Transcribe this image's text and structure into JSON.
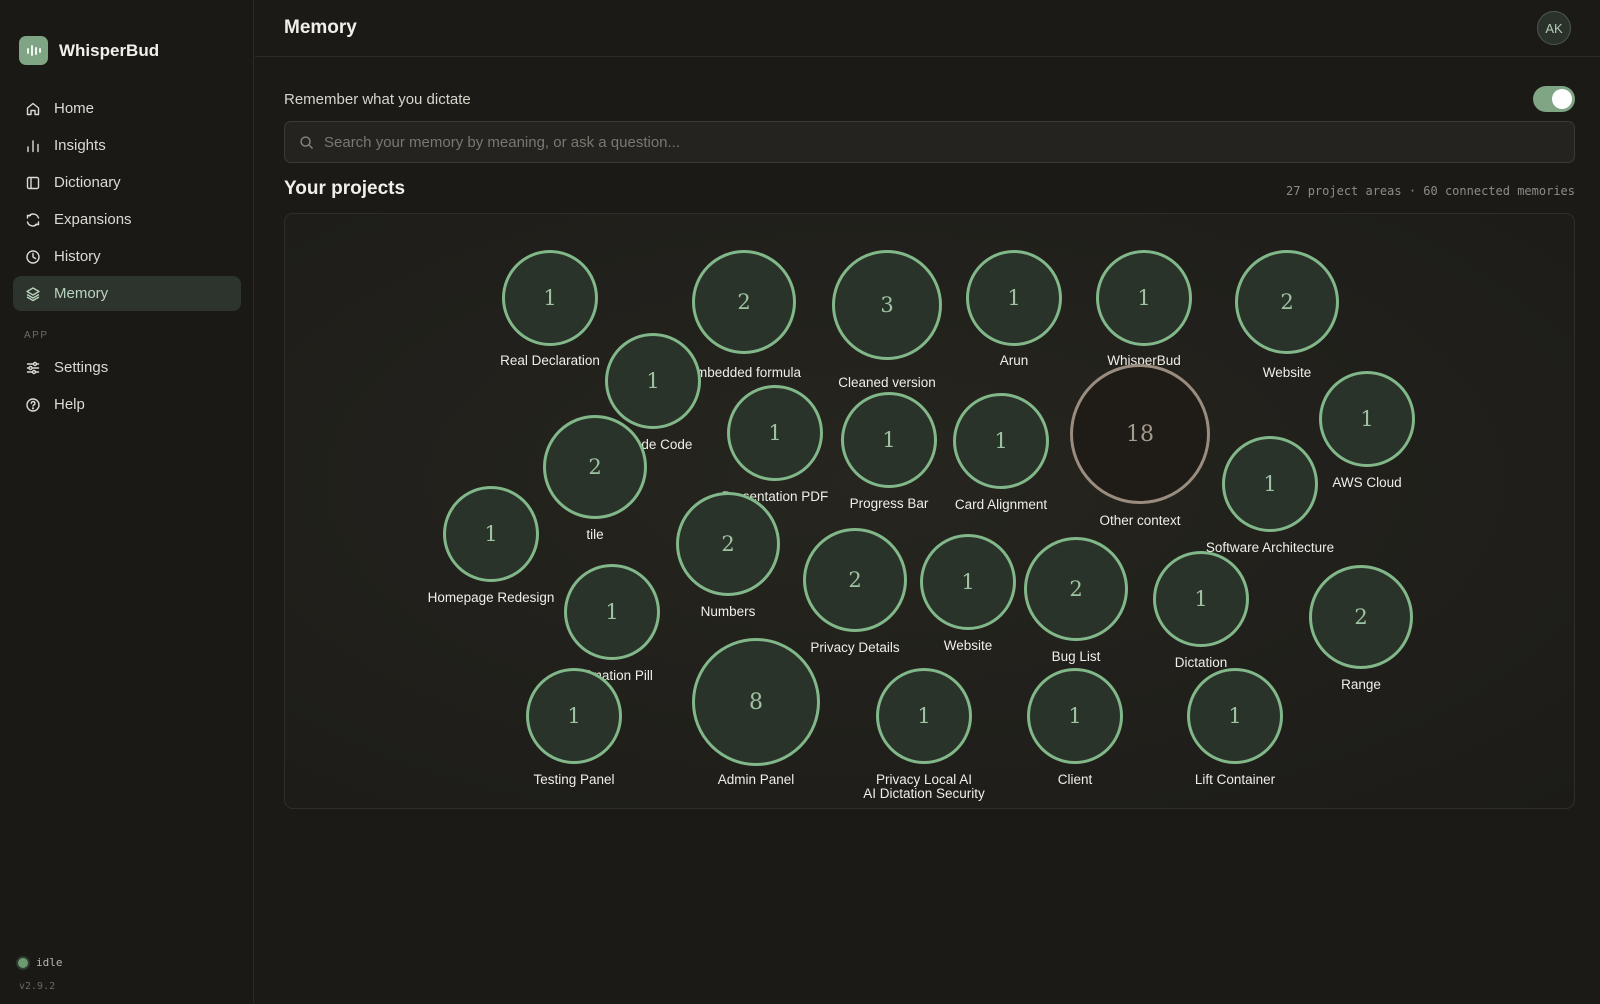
{
  "app": {
    "name": "WhisperBud"
  },
  "sidebar": {
    "items": [
      {
        "label": "Home",
        "icon": "home-icon",
        "active": false
      },
      {
        "label": "Insights",
        "icon": "bar-chart-icon",
        "active": false
      },
      {
        "label": "Dictionary",
        "icon": "book-icon",
        "active": false
      },
      {
        "label": "Expansions",
        "icon": "expand-icon",
        "active": false
      },
      {
        "label": "History",
        "icon": "clock-icon",
        "active": false
      },
      {
        "label": "Memory",
        "icon": "layers-icon",
        "active": true
      }
    ],
    "section_label": "APP",
    "app_items": [
      {
        "label": "Settings",
        "icon": "sliders-icon"
      },
      {
        "label": "Help",
        "icon": "help-circle-icon"
      }
    ],
    "status": "idle",
    "version": "v2.9.2"
  },
  "header": {
    "title": "Memory",
    "avatar": "AK"
  },
  "memory": {
    "remember_label": "Remember what you dictate",
    "remember_enabled": true,
    "search_placeholder": "Search your memory by meaning, or ask a question...",
    "section_title": "Your projects",
    "meta": "27 project areas · 60 connected memories"
  },
  "colors": {
    "accent": "#7fa585",
    "node_border": "#82b889",
    "node_fill": "#2a3329",
    "other_border": "#9a8c7f",
    "background": "#1b1a17"
  },
  "projects": [
    {
      "label": "Real Declaration",
      "count": 1
    },
    {
      "label": "Embedded formula",
      "count": 2
    },
    {
      "label": "Cleaned version",
      "count": 3
    },
    {
      "label": "Arun",
      "count": 1
    },
    {
      "label": "WhisperBud",
      "count": 1
    },
    {
      "label": "Website",
      "count": 2
    },
    {
      "label": "Claude Code",
      "count": 1
    },
    {
      "label": "Presentation PDF",
      "count": 1
    },
    {
      "label": "Progress Bar",
      "count": 1
    },
    {
      "label": "Card Alignment",
      "count": 1
    },
    {
      "label": "Other context",
      "count": 18,
      "neutral": true
    },
    {
      "label": "AWS Cloud",
      "count": 1
    },
    {
      "label": "tile",
      "count": 2
    },
    {
      "label": "Software Architecture",
      "count": 1
    },
    {
      "label": "Homepage Redesign",
      "count": 1
    },
    {
      "label": "Numbers",
      "count": 2
    },
    {
      "label": "Privacy Details",
      "count": 2
    },
    {
      "label": "Website",
      "count": 1
    },
    {
      "label": "Bug List",
      "count": 2
    },
    {
      "label": "Dictation",
      "count": 1
    },
    {
      "label": "Range",
      "count": 2
    },
    {
      "label": "Animation Pill",
      "count": 1
    },
    {
      "label": "Testing Panel",
      "count": 1
    },
    {
      "label": "Admin Panel",
      "count": 8
    },
    {
      "label": "Privacy Local AI\nAI Dictation Security",
      "count": 1
    },
    {
      "label": "Client",
      "count": 1
    },
    {
      "label": "Lift Container",
      "count": 1
    }
  ]
}
